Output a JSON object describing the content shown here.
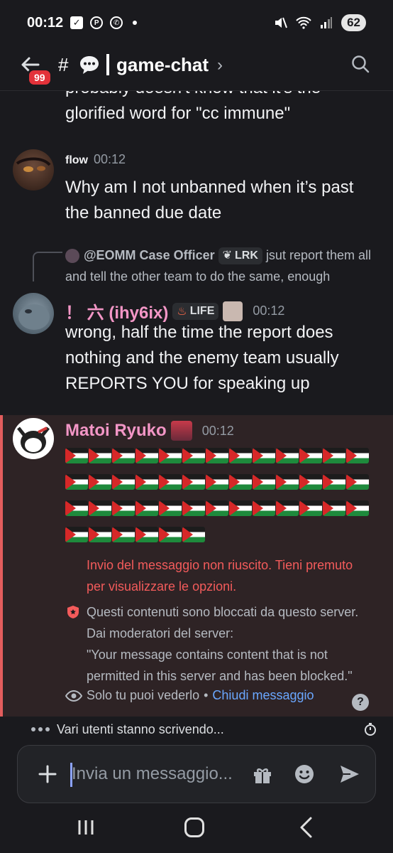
{
  "status_bar": {
    "time": "00:12",
    "battery": "62"
  },
  "header": {
    "unread_badge": "99",
    "hash": "#",
    "channel_name": "game-chat",
    "chevron": "›"
  },
  "messages": {
    "cut_text": "probably doesn't know that it's the glorified word for \"cc immune\"",
    "flow": {
      "author": "flow",
      "time": "00:12",
      "text": "Why am I not unbanned when it’s past the banned due date"
    },
    "reply": {
      "ref_author": "@EOMM Case Officer",
      "ref_tag": "LRK",
      "ref_text": "jsut report them all and tell the other team to do the same, enough"
    },
    "ihy": {
      "author": "！ 六 (ihy6ix)",
      "tag": "LIFE",
      "time": "00:12",
      "text": "wrong, half the time the report does nothing and the enemy team usually REPORTS YOU for speaking up"
    },
    "matoi": {
      "author": "Matoi Ryuko",
      "time": "00:12",
      "flag_rows": [
        13,
        13,
        13,
        6
      ],
      "error": "Invio del messaggio non riuscito. Tieni premuto per visualizzare le opzioni.",
      "blocked_line1": "Questi contenuti sono bloccati da questo server.",
      "blocked_line2": "Dai moderatori del server:",
      "blocked_quote": "\"Your message contains content that is not permitted in this server and has been blocked.\"",
      "only_you": "Solo tu puoi vederlo",
      "separator": "•",
      "dismiss": "Chiudi messaggio",
      "help": "?"
    }
  },
  "typing": {
    "text": "Vari utenti stanno scrivendo..."
  },
  "composer": {
    "placeholder": "Invia un messaggio..."
  },
  "colors": {
    "background": "#1a1a1e",
    "accent_pink": "#f396c6",
    "error_red": "#f35b5b",
    "link_blue": "#6aa7ff",
    "highlight_bg": "#2e2325"
  }
}
